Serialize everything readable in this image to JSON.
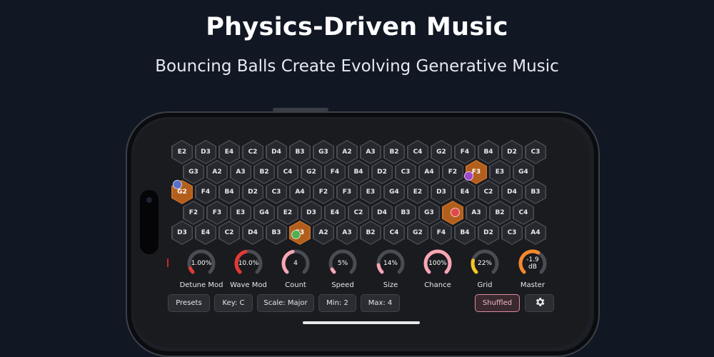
{
  "header": {
    "title": "Physics-Driven Music",
    "subtitle": "Bouncing Balls Create Evolving Generative Music"
  },
  "grid": {
    "rows": [
      [
        "E2",
        "D3",
        "E4",
        "C2",
        "D4",
        "B3",
        "G3",
        "A2",
        "A3",
        "B2",
        "C4",
        "G2",
        "F4",
        "B4",
        "D2",
        "C3"
      ],
      [
        "G3",
        "A2",
        "A3",
        "B2",
        "C4",
        "G2",
        "F4",
        "B4",
        "D2",
        "C3",
        "A4",
        "F2",
        "F3",
        "E3",
        "G4"
      ],
      [
        "G2",
        "F4",
        "B4",
        "D2",
        "C3",
        "A4",
        "F2",
        "F3",
        "E3",
        "G4",
        "E2",
        "D3",
        "E4",
        "C2",
        "D4",
        "B3"
      ],
      [
        "F2",
        "F3",
        "E3",
        "G4",
        "E2",
        "D3",
        "E4",
        "C2",
        "D4",
        "B3",
        "G3",
        "",
        "A3",
        "B2",
        "C4"
      ],
      [
        "D3",
        "E4",
        "C2",
        "D4",
        "B3",
        "E3",
        "A2",
        "A3",
        "B2",
        "C4",
        "G2",
        "F4",
        "B4",
        "D2",
        "C3",
        "A4"
      ]
    ],
    "active_cells": [
      "2-0",
      "1-12",
      "3-11",
      "4-5"
    ],
    "ball_colors": {
      "blue": "#5b6fc4",
      "purple": "#a046c8",
      "red": "#e0484a",
      "green": "#4fb04f"
    },
    "colors": {
      "active_fill": "#b25e1c",
      "cell_fill": "#26282e"
    }
  },
  "knobs": [
    {
      "label": "Detune Mod",
      "value": "1.00%",
      "fraction": 0.08,
      "color": "#e53935"
    },
    {
      "label": "Wave Mod",
      "value": "10.0%",
      "fraction": 0.45,
      "color": "#e53935"
    },
    {
      "label": "Count",
      "value": "4",
      "fraction": 0.45,
      "color": "#f7a6b4"
    },
    {
      "label": "Speed",
      "value": "5%",
      "fraction": 0.06,
      "color": "#f7a6b4"
    },
    {
      "label": "Size",
      "value": "14%",
      "fraction": 0.14,
      "color": "#f7a6b4"
    },
    {
      "label": "Chance",
      "value": "100%",
      "fraction": 1.0,
      "color": "#f7a6b4"
    },
    {
      "label": "Grid",
      "value": "22%",
      "fraction": 0.22,
      "color": "#f3c623"
    },
    {
      "label": "Master",
      "value": "-1.9\ndB",
      "fraction": 0.6,
      "color": "#f5892c"
    }
  ],
  "toolbar": {
    "presets": "Presets",
    "key": "Key: C",
    "scale": "Scale: Major",
    "min": "Min: 2",
    "max": "Max: 4",
    "shuffled": "Shuffled",
    "settings_icon": "gear-icon"
  }
}
